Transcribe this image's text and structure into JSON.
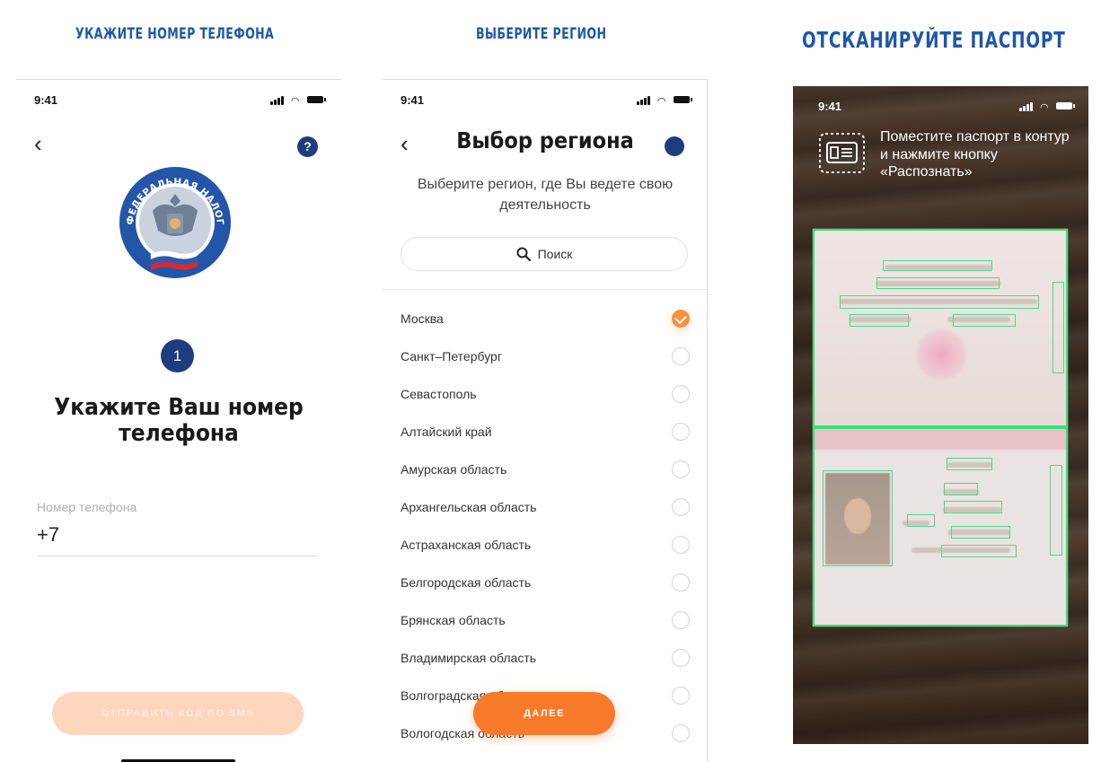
{
  "captions": {
    "phone_step": "УКАЖИТЕ НОМЕР ТЕЛЕФОНА",
    "region_step": "ВЫБЕРИТЕ РЕГИОН",
    "scan_step": "ОТСКАНИРУЙТЕ ПАСПОРТ"
  },
  "status_bar": {
    "time": "9:41"
  },
  "phone_screen": {
    "back_glyph": "‹",
    "help_glyph": "?",
    "step_number": "1",
    "title": "Укажите Ваш номер телефона",
    "field_label": "Номер телефона",
    "field_value": "+7",
    "send_button": "ОТПРАВИТЬ КОД ПО SMS",
    "emblem_text": "ФЕДЕРАЛЬНАЯ НАЛОГОВАЯ СЛУЖБА"
  },
  "region_screen": {
    "back_glyph": "‹",
    "title": "Выбор региона",
    "subtitle": "Выберите регион, где Вы ведете свою деятельность",
    "search_placeholder": "Поиск",
    "regions": [
      {
        "name": "Москва",
        "selected": true
      },
      {
        "name": "Санкт–Петербург",
        "selected": false
      },
      {
        "name": "Севастополь",
        "selected": false
      },
      {
        "name": "Алтайский край",
        "selected": false
      },
      {
        "name": "Амурская область",
        "selected": false
      },
      {
        "name": "Архангельская область",
        "selected": false
      },
      {
        "name": "Астраханская область",
        "selected": false
      },
      {
        "name": "Белгородская область",
        "selected": false
      },
      {
        "name": "Брянская область",
        "selected": false
      },
      {
        "name": "Владимирская область",
        "selected": false
      },
      {
        "name": "Волгоградская область",
        "selected": false
      },
      {
        "name": "Вологодская область",
        "selected": false
      }
    ],
    "next_button": "ДАЛЕЕ"
  },
  "scan_screen": {
    "hint": "Поместите паспорт в контур и нажмите кнопку «Распознать»"
  },
  "colors": {
    "brand_blue": "#1d3d7e",
    "caption_blue": "#1f57a8",
    "accent_orange": "#f77a2a",
    "scan_green": "#39e07a"
  }
}
